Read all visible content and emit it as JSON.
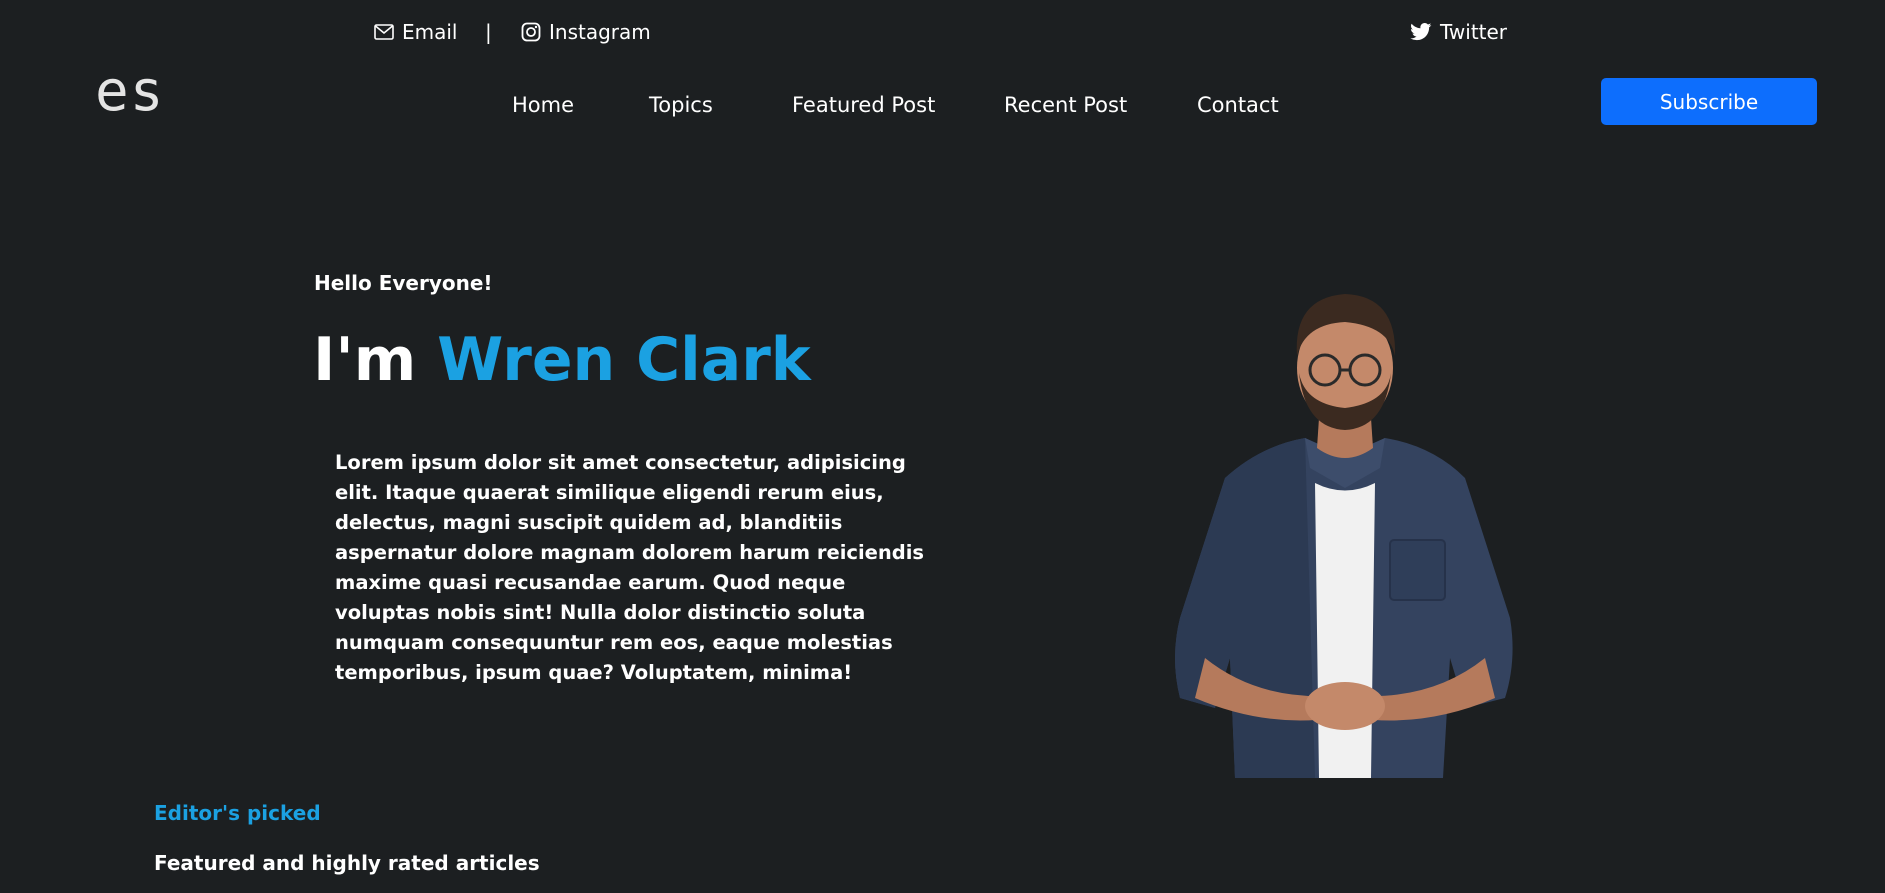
{
  "topbar": {
    "email_label": "Email",
    "separator": "|",
    "instagram_label": "Instagram",
    "twitter_label": "Twitter"
  },
  "nav": {
    "logo": "es",
    "items": [
      "Home",
      "Topics",
      "Featured Post",
      "Recent Post",
      "Contact"
    ],
    "subscribe_label": "Subscribe"
  },
  "hero": {
    "greeting": "Hello Everyone!",
    "title_prefix": "I'm",
    "name": "Wren Clark",
    "description": "Lorem ipsum dolor sit amet consectetur, adipisicing elit. Itaque quaerat similique eligendi rerum eius, delectus, magni suscipit quidem ad, blanditiis aspernatur dolore magnam dolorem harum reiciendis maxime quasi recusandae earum. Quod neque voluptas nobis sint! Nulla dolor distinctio soluta numquam consequuntur rem eos, eaque molestias temporibus, ipsum quae? Voluptatem, minima!"
  },
  "editors": {
    "label": "Editor's picked",
    "subtitle": "Featured and highly rated articles"
  },
  "colors": {
    "background": "#1c1f21",
    "accent": "#1ba1e2",
    "button": "#0d6efd"
  },
  "icons": [
    "envelope-icon",
    "instagram-icon",
    "twitter-icon"
  ]
}
